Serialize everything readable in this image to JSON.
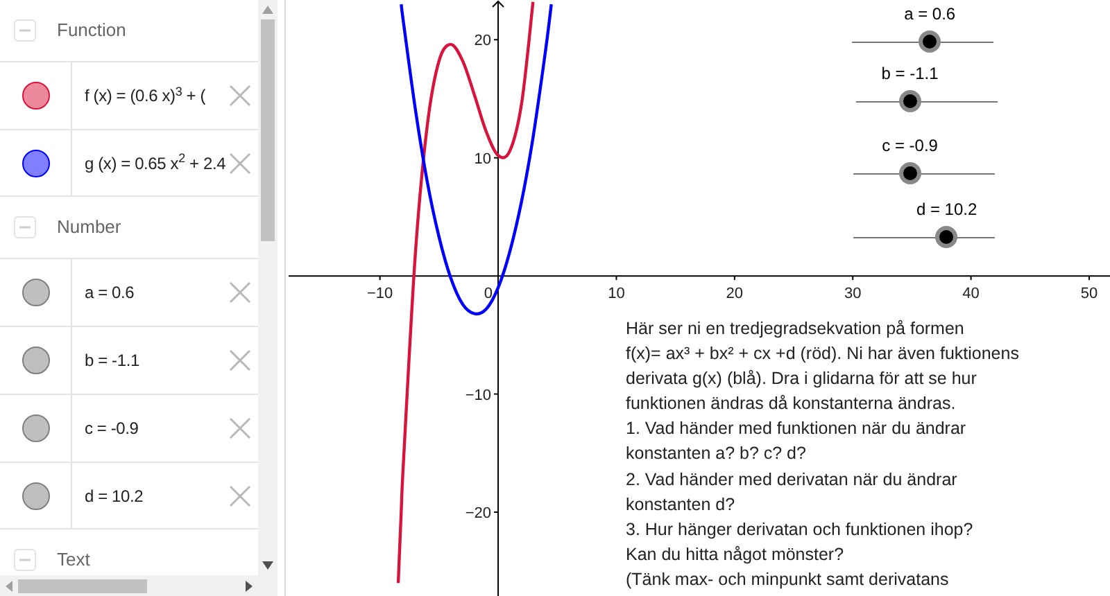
{
  "algebra": {
    "groups": [
      {
        "title": "Function",
        "expanded": true,
        "items": [
          {
            "text": "f (x) = (0.6 x)$^{3}$ + (",
            "color": "#dc143c"
          },
          {
            "text": "g (x) = 0.65 x$^{2}$ + 2.4",
            "color": "#0000ff"
          }
        ]
      },
      {
        "title": "Number",
        "expanded": true,
        "items": [
          {
            "text": "a = 0.6",
            "color": "#808080"
          },
          {
            "text": "b = -1.1",
            "color": "#808080"
          },
          {
            "text": "c = -0.9",
            "color": "#808080"
          },
          {
            "text": "d = 10.2",
            "color": "#808080"
          }
        ]
      },
      {
        "title": "Text",
        "expanded": true
      }
    ]
  },
  "graphics": {
    "chart_data": {
      "type": "line",
      "x": [
        -8.45,
        -8.2,
        -8,
        -7,
        -6,
        -5,
        -4,
        -3,
        -2,
        -1,
        0,
        1,
        2,
        2.95,
        4,
        4.5
      ],
      "series": [
        {
          "color": "#d6143c",
          "values": [
            -26,
            -20,
            -15.6,
            1.9,
            12.7,
            18.2,
            19.6,
            18.2,
            15.3,
            12.2,
            10.2,
            10.6,
            14.7,
            23.2,
            null,
            null
          ]
        },
        {
          "color": "#0000ff",
          "values": [
            null,
            23,
            21.4,
            14.1,
            8,
            3.3,
            -0.2,
            -2.4,
            -3.2,
            -2.8,
            -1,
            2.1,
            6.4,
            11.7,
            19,
            23
          ]
        }
      ],
      "xlim": [
        -17.96,
        51.76
      ],
      "ylim": [
        -27.1,
        23.36
      ],
      "xticks": [
        {
          "value": -10,
          "label": "−10"
        },
        10,
        20,
        30,
        40,
        50
      ],
      "yticks": [
        {
          "value": -20,
          "label": "−20"
        },
        {
          "value": -10,
          "label": "−10"
        },
        10,
        20
      ]
    },
    "origin_label": "0",
    "sliders": [
      {
        "label": "a = 0.6",
        "level": 0.55
      },
      {
        "label": "b = -1.1",
        "level": 0.38
      },
      {
        "label": "c = -0.9",
        "level": 0.4
      },
      {
        "label": "d = 10.2",
        "level": 0.66
      }
    ],
    "text_lines": [
      "Här ser ni en tredjegradsekvation på formen",
      "f(x)= ax³ + bx² + cx +d (röd). Ni har även fuktionens",
      "derivata g(x) (blå). Dra i glidarna för att se hur",
      "funktionen ändras då konstanterna ändras.",
      "1. Vad händer med funktionen när du ändrar",
      "konstanten a? b? c? d?",
      "2. Vad händer med derivatan när du ändrar",
      "konstanten d?",
      "3. Hur hänger derivatan och funktionen ihop?",
      "Kan du hitta något mönster?",
      "(Tänk max- och minpunkt samt derivatans"
    ]
  }
}
